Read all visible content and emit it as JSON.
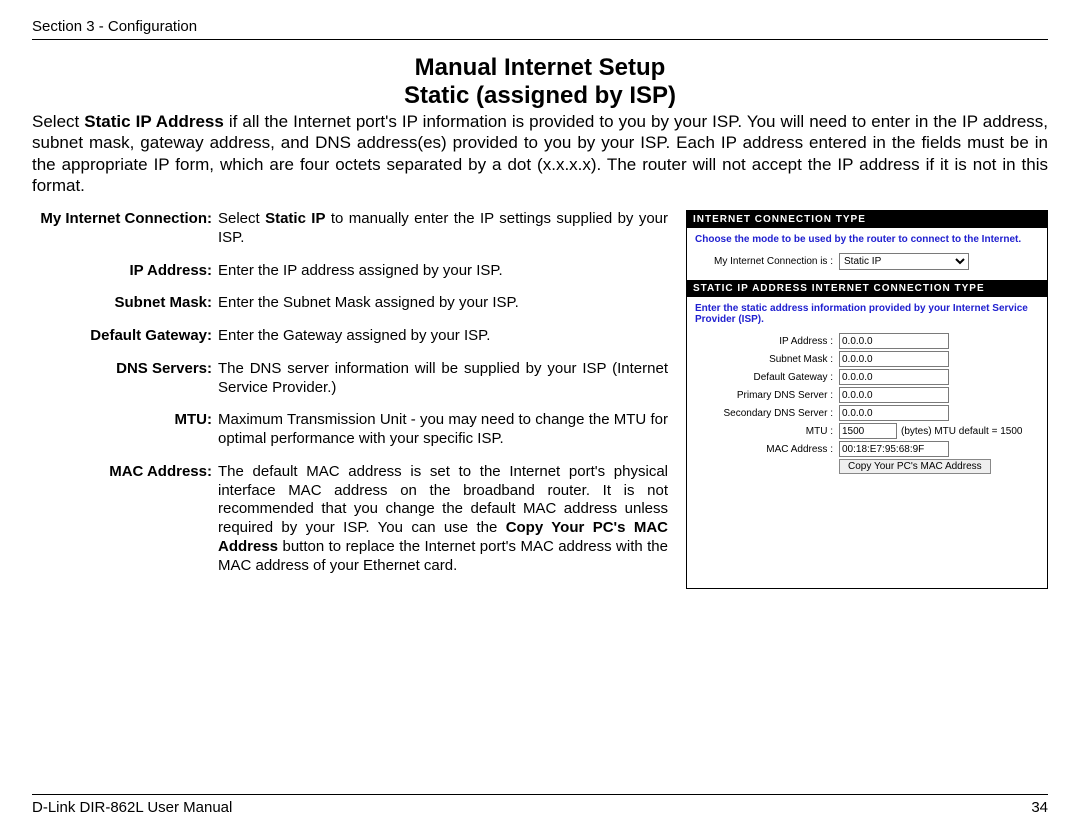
{
  "header": "Section 3 - Configuration",
  "title_line1": "Manual Internet Setup",
  "title_line2": "Static (assigned by ISP)",
  "intro_pre": "Select ",
  "intro_bold": "Static IP Address",
  "intro_post": " if all the Internet port's IP information is provided to you by your ISP. You will need to enter in the IP address, subnet mask, gateway address, and DNS address(es) provided to you by your ISP. Each IP address entered in the fields must be in the appropriate IP form, which are four octets separated by a dot (x.x.x.x). The router will not accept the IP address if it is not in this format.",
  "defs": {
    "myconn": {
      "label": "My Internet Connection:",
      "pre": "Select ",
      "bold": "Static IP",
      "post": " to manually enter the IP settings supplied by your ISP."
    },
    "ip": {
      "label": "IP Address:",
      "body": "Enter the IP address assigned by your ISP."
    },
    "subnet": {
      "label": "Subnet Mask:",
      "body": "Enter the Subnet Mask assigned by your ISP."
    },
    "gateway": {
      "label": "Default Gateway:",
      "body": "Enter the Gateway assigned by your ISP."
    },
    "dns": {
      "label": "DNS Servers:",
      "body": "The DNS server information will be supplied by your ISP (Internet Service Provider.)"
    },
    "mtu": {
      "label": "MTU:",
      "body": "Maximum Transmission Unit - you may need to change the MTU for optimal performance with your specific ISP."
    },
    "mac": {
      "label": "MAC Address:",
      "pre": "The default MAC address is set to the Internet port's physical interface MAC address on the broadband router. It is not recommended that you change the default MAC address unless required by your ISP.  You can use the ",
      "bold": "Copy Your PC's MAC Address",
      "post": " button to replace the Internet port's MAC address with the MAC address of your Ethernet card."
    }
  },
  "panel": {
    "sect1_head": "INTERNET CONNECTION TYPE",
    "sect1_hint": "Choose the mode to be used by the router to connect to the Internet.",
    "conn_label": "My Internet Connection is :",
    "conn_value": "Static IP",
    "sect2_head": "STATIC IP ADDRESS INTERNET CONNECTION TYPE",
    "sect2_hint": "Enter the static address information provided by your Internet Service Provider (ISP).",
    "rows": {
      "ip": {
        "label": "IP Address :",
        "value": "0.0.0.0"
      },
      "subnet": {
        "label": "Subnet Mask :",
        "value": "0.0.0.0"
      },
      "gateway": {
        "label": "Default Gateway :",
        "value": "0.0.0.0"
      },
      "pdns": {
        "label": "Primary DNS Server :",
        "value": "0.0.0.0"
      },
      "sdns": {
        "label": "Secondary DNS Server :",
        "value": "0.0.0.0"
      },
      "mtu": {
        "label": "MTU :",
        "value": "1500",
        "after": "(bytes) MTU default = 1500"
      },
      "mac": {
        "label": "MAC Address :",
        "value": "00:18:E7:95:68:9F"
      }
    },
    "copy_btn": "Copy Your PC's MAC Address"
  },
  "footer_left": "D-Link DIR-862L User Manual",
  "footer_right": "34"
}
